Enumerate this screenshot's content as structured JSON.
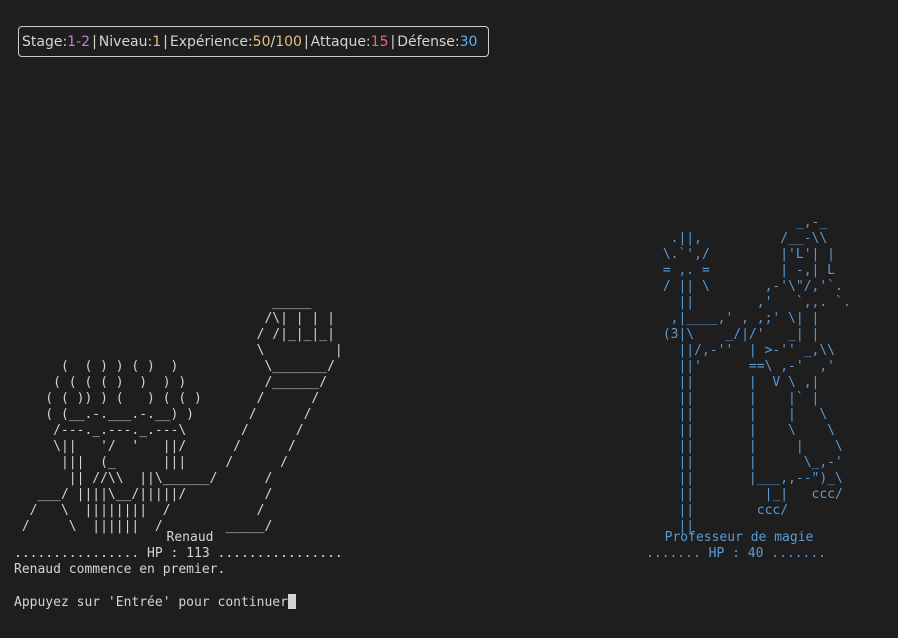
{
  "status": {
    "stage_label": "Stage:",
    "stage_value_a": "1",
    "stage_dash": "-",
    "stage_value_b": "2",
    "sep": "|",
    "level_label": "Niveau:",
    "level_value": "1",
    "xp_label": "Expérience:",
    "xp_current": "50",
    "xp_slash": "/",
    "xp_max": "100",
    "attack_label": "Attaque:",
    "attack_value": "15",
    "defense_label": "Défense:",
    "defense_value": "30",
    "colors": {
      "stage": "#c678dd",
      "level": "#e5c07b",
      "xp": "#e5c07b",
      "attack": "#e06c75",
      "defense": "#61afef"
    }
  },
  "hero": {
    "name": "Renaud",
    "hp_line": "................ HP : 113 ................",
    "art": "                                 _____\n                                /\\| | | |\n                               / /|_|_|_|\n                               \\         |\n      (  ( ) ) ( )  )           \\_______/\n     ( ( ( ( )  )  ) )          /______/\n    ( ( )) ) (   ) ( ( )       /      /\n    ( (__.-.___.-.__) )       /      /\n     /---._.---._.---\\       /      /\n     \\||   '/  '   ||/      /      /\n      |||  (_      |||     /      /\n       || //\\\\  ||\\______/      /\n   ___/ ||||\\__/|||||/          /\n  /   \\  ||||||||  /           /\n /     \\  ||||||  /        _____/"
  },
  "enemy": {
    "name": "Professeur de magie",
    "hp_line": "....... HP : 40 .......",
    "art": "                  _,-_\n  .||,          /__-\\\\\n \\.`',/         |'L'| |\n = ,. =         | -,| L\n / || \\       ,-'\\\"/,'`.\n   ||        ,'   `,,. `.\n  ,|____,' , ,;' \\| |\n (3|\\    _/|/'   _| |\n   ||/,-''  | >-'' _,\\\\\n   ||'      ==\\ ,-'  ,'\n   ||       |  V \\ ,|\n   ||       |    |` |\n   ||       |    |   \\\n   ||       |    \\    \\\n   ||       |     |    \\\n   ||       |      \\_,-'\n   ||       |___,,--\")_\\\n   ||         |_|   ccc/\n   ||        ccc/\n   ||"
  },
  "messages": {
    "first_turn": "Renaud commence en premier.",
    "continue_prompt": "Appuyez sur 'Entrée' pour continuer"
  }
}
